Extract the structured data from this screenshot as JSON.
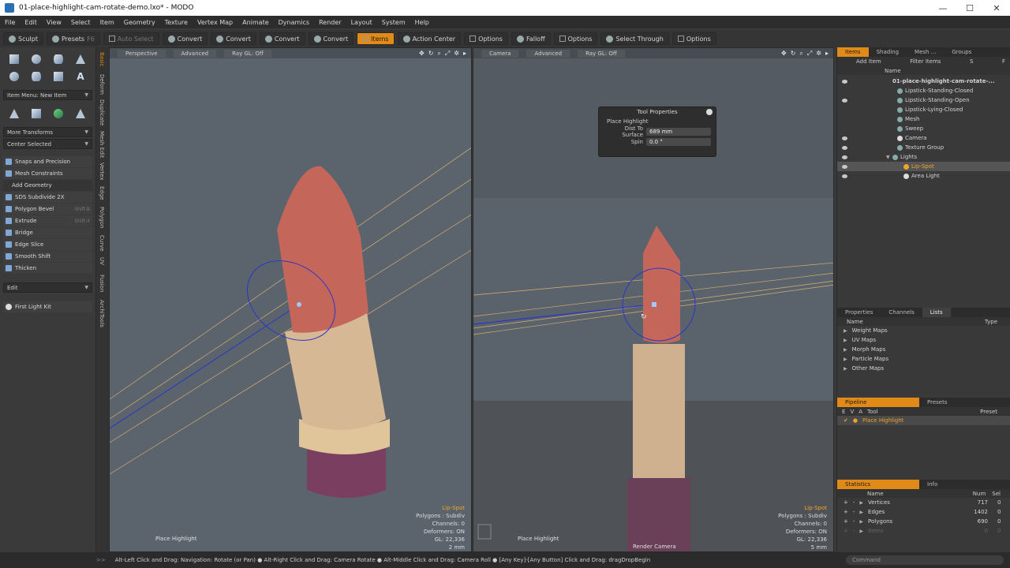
{
  "window": {
    "title": "01-place-highlight-cam-rotate-demo.lxo* - MODO",
    "minimize": "—",
    "maximize": "☐",
    "close": "✕"
  },
  "menu": [
    "File",
    "Edit",
    "View",
    "Select",
    "Item",
    "Geometry",
    "Texture",
    "Vertex Map",
    "Animate",
    "Dynamics",
    "Render",
    "Layout",
    "System",
    "Help"
  ],
  "toolbar": {
    "sculpt": "Sculpt",
    "presets": "Presets",
    "presets_key": "F6",
    "auto_select": "Auto Select",
    "convert1": "Convert",
    "convert2": "Convert",
    "convert3": "Convert",
    "convert4": "Convert",
    "items": "Items",
    "action_center": "Action Center",
    "options1": "Options",
    "falloff": "Falloff",
    "options2": "Options",
    "select_through": "Select Through",
    "options3": "Options"
  },
  "left_panel": {
    "item_menu": "Item Menu: New Item",
    "more_transforms": "More Transforms",
    "center_selected": "Center Selected",
    "snaps": "Snaps and Precision",
    "mesh_constraints": "Mesh Constraints",
    "add_geometry": "Add Geometry",
    "tools": [
      {
        "label": "SDS Subdivide 2X",
        "key": ""
      },
      {
        "label": "Polygon Bevel",
        "key": "Shift-B"
      },
      {
        "label": "Extrude",
        "key": "Shift-X"
      },
      {
        "label": "Bridge",
        "key": ""
      },
      {
        "label": "Edge Slice",
        "key": ""
      },
      {
        "label": "Smooth Shift",
        "key": ""
      },
      {
        "label": "Thicken",
        "key": ""
      }
    ],
    "edit": "Edit",
    "first_light_kit": "First Light Kit"
  },
  "vtabs": [
    "Basic",
    "Deform",
    "Duplicate",
    "Mesh Edit",
    "Vertex",
    "Edge",
    "Polygon",
    "Curve",
    "UV",
    "Fusion",
    "ArchiTools"
  ],
  "viewport_left": {
    "tabs": [
      "Perspective",
      "Advanced",
      "Ray GL: Off"
    ],
    "tool": "Place Highlight",
    "info": {
      "item": "Lip-Spot",
      "polygons": "Polygons : Subdiv",
      "channels": "Channels: 0",
      "deformers": "Deformers: ON",
      "gl": "GL: 22,336",
      "scale": "2 mm"
    }
  },
  "viewport_right": {
    "tabs": [
      "Camera",
      "Advanced",
      "Ray GL: Off"
    ],
    "tool": "Place Highlight",
    "bottom_label": "Render Camera",
    "info": {
      "item": "Lip-Spot",
      "polygons": "Polygons : Subdiv",
      "channels": "Channels: 0",
      "deformers": "Deformers: ON",
      "gl": "GL: 22,336",
      "scale": "5 mm"
    }
  },
  "tool_properties": {
    "title": "Tool Properties",
    "section": "Place Highlight",
    "dist_label": "Dist To Surface",
    "dist_value": "689 mm",
    "spin_label": "Spin",
    "spin_value": "0.0 °"
  },
  "items_panel": {
    "tabs": [
      "Items",
      "Shading",
      "Mesh ...",
      "Groups"
    ],
    "add_item": "Add Item",
    "filter_items": "Filter Items",
    "s_btn": "S",
    "f_btn": "F",
    "name_col": "Name",
    "rows": [
      {
        "label": "01-place-highlight-cam-rotate-...",
        "indent": 0
      },
      {
        "label": "Lipstick-Standing-Closed",
        "indent": 2
      },
      {
        "label": "Lipstick-Standing-Open",
        "indent": 2
      },
      {
        "label": "Lipstick-Lying-Closed",
        "indent": 2
      },
      {
        "label": "Mesh",
        "indent": 2
      },
      {
        "label": "Sweep",
        "indent": 2
      },
      {
        "label": "Camera",
        "indent": 2
      },
      {
        "label": "Texture Group",
        "indent": 2
      },
      {
        "label": "Lights",
        "indent": 1
      },
      {
        "label": "Lip-Spot",
        "indent": 3
      },
      {
        "label": "Area Light",
        "indent": 3
      }
    ]
  },
  "lists_panel": {
    "tabs": [
      "Properties",
      "Channels",
      "Lists"
    ],
    "name_col": "Name",
    "type_col": "Type",
    "rows": [
      "Weight Maps",
      "UV Maps",
      "Morph Maps",
      "Particle Maps",
      "Other Maps"
    ]
  },
  "pipeline_panel": {
    "tabs": [
      "Pipeline",
      "Presets"
    ],
    "cols": [
      "E",
      "V",
      "A",
      "Tool",
      "Preset"
    ],
    "row": "Place Highlight"
  },
  "stats_panel": {
    "tabs": [
      "Statistics",
      "Info"
    ],
    "cols": [
      "Name",
      "Num",
      "Sel"
    ],
    "rows": [
      {
        "name": "Vertices",
        "num": "717",
        "sel": "0"
      },
      {
        "name": "Edges",
        "num": "1402",
        "sel": "0"
      },
      {
        "name": "Polygons",
        "num": "690",
        "sel": "0"
      },
      {
        "name": "Items",
        "num": "0",
        "sel": "0"
      }
    ]
  },
  "status": {
    "text": "Alt-Left Click and Drag: Navigation: Rotate (or Pan) ● Alt-Right Click and Drag: Camera Rotate ● Alt-Middle Click and Drag: Camera Roll ● [Any Key]-[Any Button] Click and Drag: dragDropBegin",
    "command": "Command"
  },
  "colors": {
    "accent": "#e28a18",
    "viewport": "#5b646d",
    "lipstick": "#c56a5c",
    "case": "#d8bfa0",
    "base": "#7a3f60"
  }
}
